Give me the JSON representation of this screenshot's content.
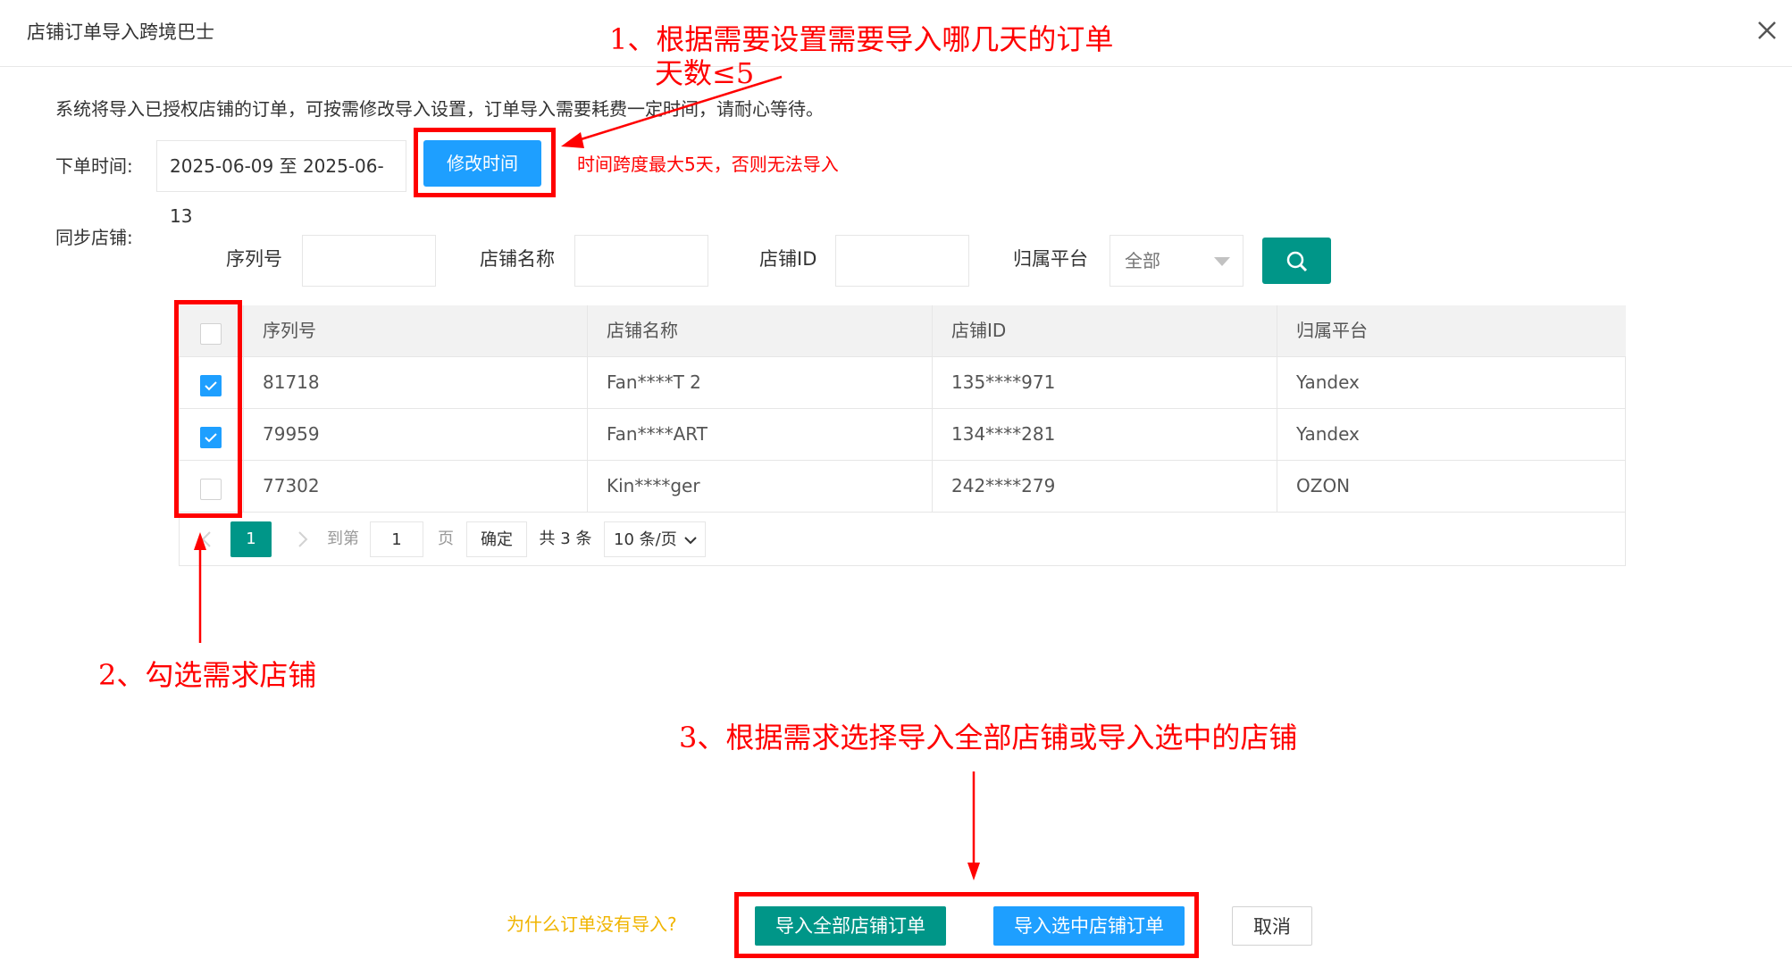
{
  "dialog": {
    "title": "店铺订单导入跨境巴士",
    "intro": "系统将导入已授权店铺的订单，可按需修改导入设置，订单导入需要耗费一定时间，请耐心等待。"
  },
  "order_time": {
    "label": "下单时间:",
    "range": "2025-06-09 至 2025-06-13",
    "edit_button": "修改时间",
    "limit_note": "时间跨度最大5天，否则无法导入"
  },
  "sync_shops": {
    "label": "同步店铺:",
    "search": {
      "serial_label": "序列号",
      "name_label": "店铺名称",
      "id_label": "店铺ID",
      "platform_label": "归属平台",
      "platform_value": "全部"
    }
  },
  "table": {
    "headers": [
      "序列号",
      "店铺名称",
      "店铺ID",
      "归属平台"
    ],
    "rows": [
      {
        "checked": true,
        "serial": "81718",
        "name": "Fan****T 2",
        "shop_id": "135****971",
        "platform": "Yandex"
      },
      {
        "checked": true,
        "serial": "79959",
        "name": "Fan****ART",
        "shop_id": "134****281",
        "platform": "Yandex"
      },
      {
        "checked": false,
        "serial": "77302",
        "name": "Kin****ger",
        "shop_id": "242****279",
        "platform": "OZON"
      }
    ]
  },
  "pager": {
    "current_page": "1",
    "goto_label": "到第",
    "goto_value": "1",
    "page_unit": "页",
    "confirm": "确定",
    "total": "共 3 条",
    "page_size": "10 条/页"
  },
  "footer": {
    "help_link": "为什么订单没有导入?",
    "import_all": "导入全部店铺订单",
    "import_selected": "导入选中店铺订单",
    "cancel": "取消"
  },
  "annotations": {
    "note1_line1": "1、根据需要设置需要导入哪几天的订单",
    "note1_line2": "天数≤5",
    "note2": "2、勾选需求店铺",
    "note3": "3、根据需求选择导入全部店铺或导入选中的店铺"
  },
  "colors": {
    "primary_blue": "#1e9fff",
    "teal": "#009688",
    "annotation_red": "#ff0000",
    "help_yellow": "#f0b400"
  }
}
